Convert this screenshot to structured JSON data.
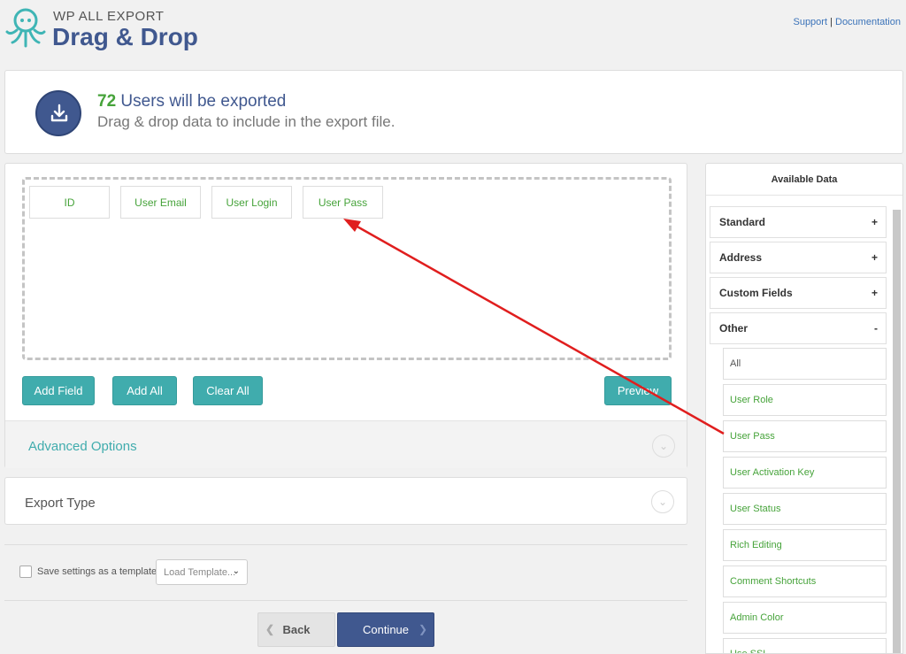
{
  "header": {
    "brand_small": "WP ALL EXPORT",
    "brand_big": "Drag & Drop",
    "support_link": "Support",
    "separator": "|",
    "docs_link": "Documentation"
  },
  "summary": {
    "count": "72",
    "title_rest": "Users will be exported",
    "subtitle": "Drag & drop data to include in the export file.",
    "icon": "download-icon"
  },
  "dropzone": {
    "fields": [
      "ID",
      "User Email",
      "User Login",
      "User Pass"
    ]
  },
  "buttons": {
    "add_field": "Add Field",
    "add_all": "Add All",
    "clear_all": "Clear All",
    "preview": "Preview"
  },
  "sections": {
    "advanced_options": "Advanced Options",
    "export_type": "Export Type"
  },
  "template": {
    "save_label": "Save settings as a template",
    "load_placeholder": "Load Template..."
  },
  "nav": {
    "back": "Back",
    "continue": "Continue"
  },
  "available": {
    "title": "Available Data",
    "categories": [
      {
        "label": "Standard",
        "sign": "+"
      },
      {
        "label": "Address",
        "sign": "+"
      },
      {
        "label": "Custom Fields",
        "sign": "+"
      },
      {
        "label": "Other",
        "sign": "-"
      }
    ],
    "other_items": [
      "All",
      "User Role",
      "User Pass",
      "User Activation Key",
      "User Status",
      "Rich Editing",
      "Comment Shortcuts",
      "Admin Color",
      "Use SSL"
    ]
  },
  "colors": {
    "brand_blue": "#40588f",
    "teal": "#40acad",
    "green": "#46a33a",
    "annotation_red": "#e01e1e"
  }
}
